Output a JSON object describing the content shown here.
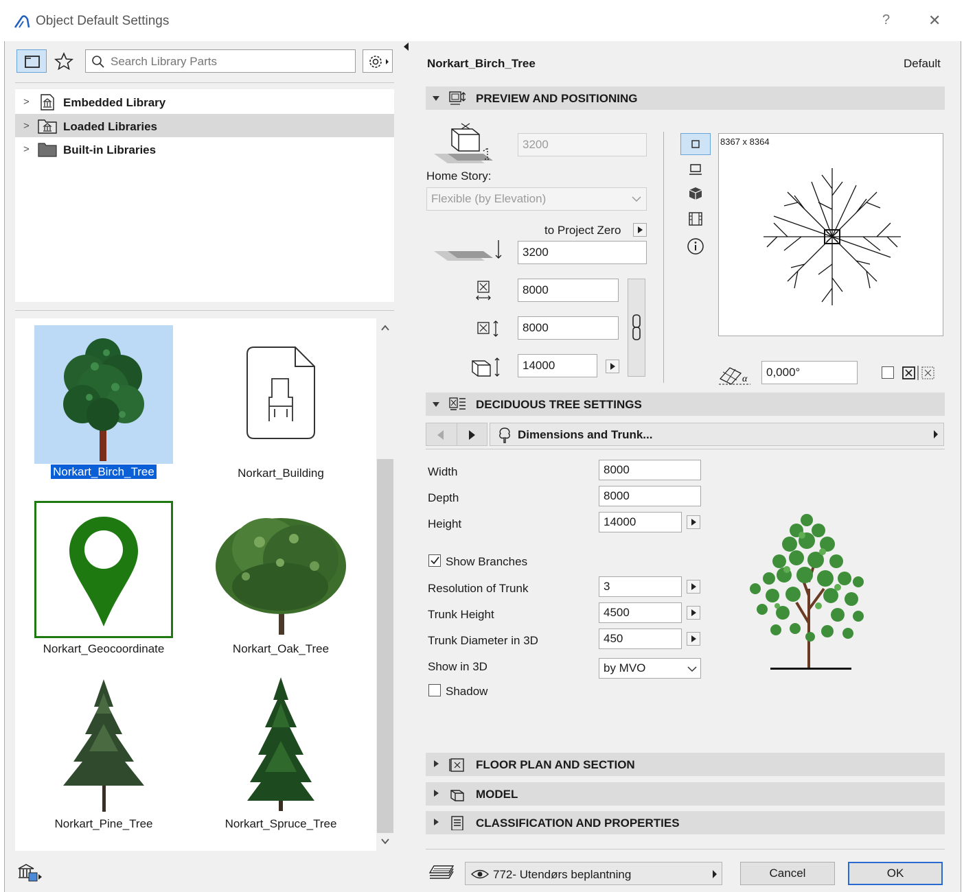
{
  "window": {
    "title": "Object Default Settings",
    "help": "?",
    "close": "✕"
  },
  "left": {
    "search_placeholder": "Search Library Parts",
    "tree": [
      {
        "label": "Embedded Library"
      },
      {
        "label": "Loaded Libraries"
      },
      {
        "label": "Built-in Libraries"
      }
    ],
    "thumbs": [
      {
        "label": "Norkart_Birch_Tree"
      },
      {
        "label": "Norkart_Building"
      },
      {
        "label": "Norkart_Geocoordinate"
      },
      {
        "label": "Norkart_Oak_Tree"
      },
      {
        "label": "Norkart_Pine_Tree"
      },
      {
        "label": "Norkart_Spruce_Tree"
      }
    ]
  },
  "right": {
    "object_name": "Norkart_Birch_Tree",
    "default_label": "Default",
    "sections": {
      "preview": "PREVIEW AND POSITIONING",
      "deciduous": "DECIDUOUS TREE SETTINGS",
      "floorplan": "FLOOR PLAN AND SECTION",
      "model": "MODEL",
      "classification": "CLASSIFICATION AND PROPERTIES"
    },
    "positioning": {
      "elevation_value": "3200",
      "home_story_label": "Home Story:",
      "home_story_value": "Flexible (by Elevation)",
      "to_project_zero": "to Project Zero",
      "project_zero_value": "3200",
      "width_value": "8000",
      "depth_value": "8000",
      "height_value": "14000",
      "preview_size": "8367 x 8364",
      "rotation_value": "0,000°"
    },
    "params": {
      "page_label": "Dimensions and Trunk...",
      "width_label": "Width",
      "width_value": "8000",
      "depth_label": "Depth",
      "depth_value": "8000",
      "height_label": "Height",
      "height_value": "14000",
      "show_branches": "Show Branches",
      "res_label": "Resolution of Trunk",
      "res_value": "3",
      "trunk_h_label": "Trunk Height",
      "trunk_h_value": "4500",
      "trunk_d_label": "Trunk Diameter in 3D",
      "trunk_d_value": "450",
      "show3d_label": "Show in 3D",
      "show3d_value": "by MVO",
      "shadow_label": "Shadow"
    },
    "footer": {
      "layer": "772- Utendørs beplantning",
      "cancel": "Cancel",
      "ok": "OK"
    }
  },
  "colors": {
    "accent": "#0a5fd6",
    "selection": "#bcd9f5",
    "geo_green": "#1e7a10",
    "ok_border": "#2a6ad0"
  }
}
